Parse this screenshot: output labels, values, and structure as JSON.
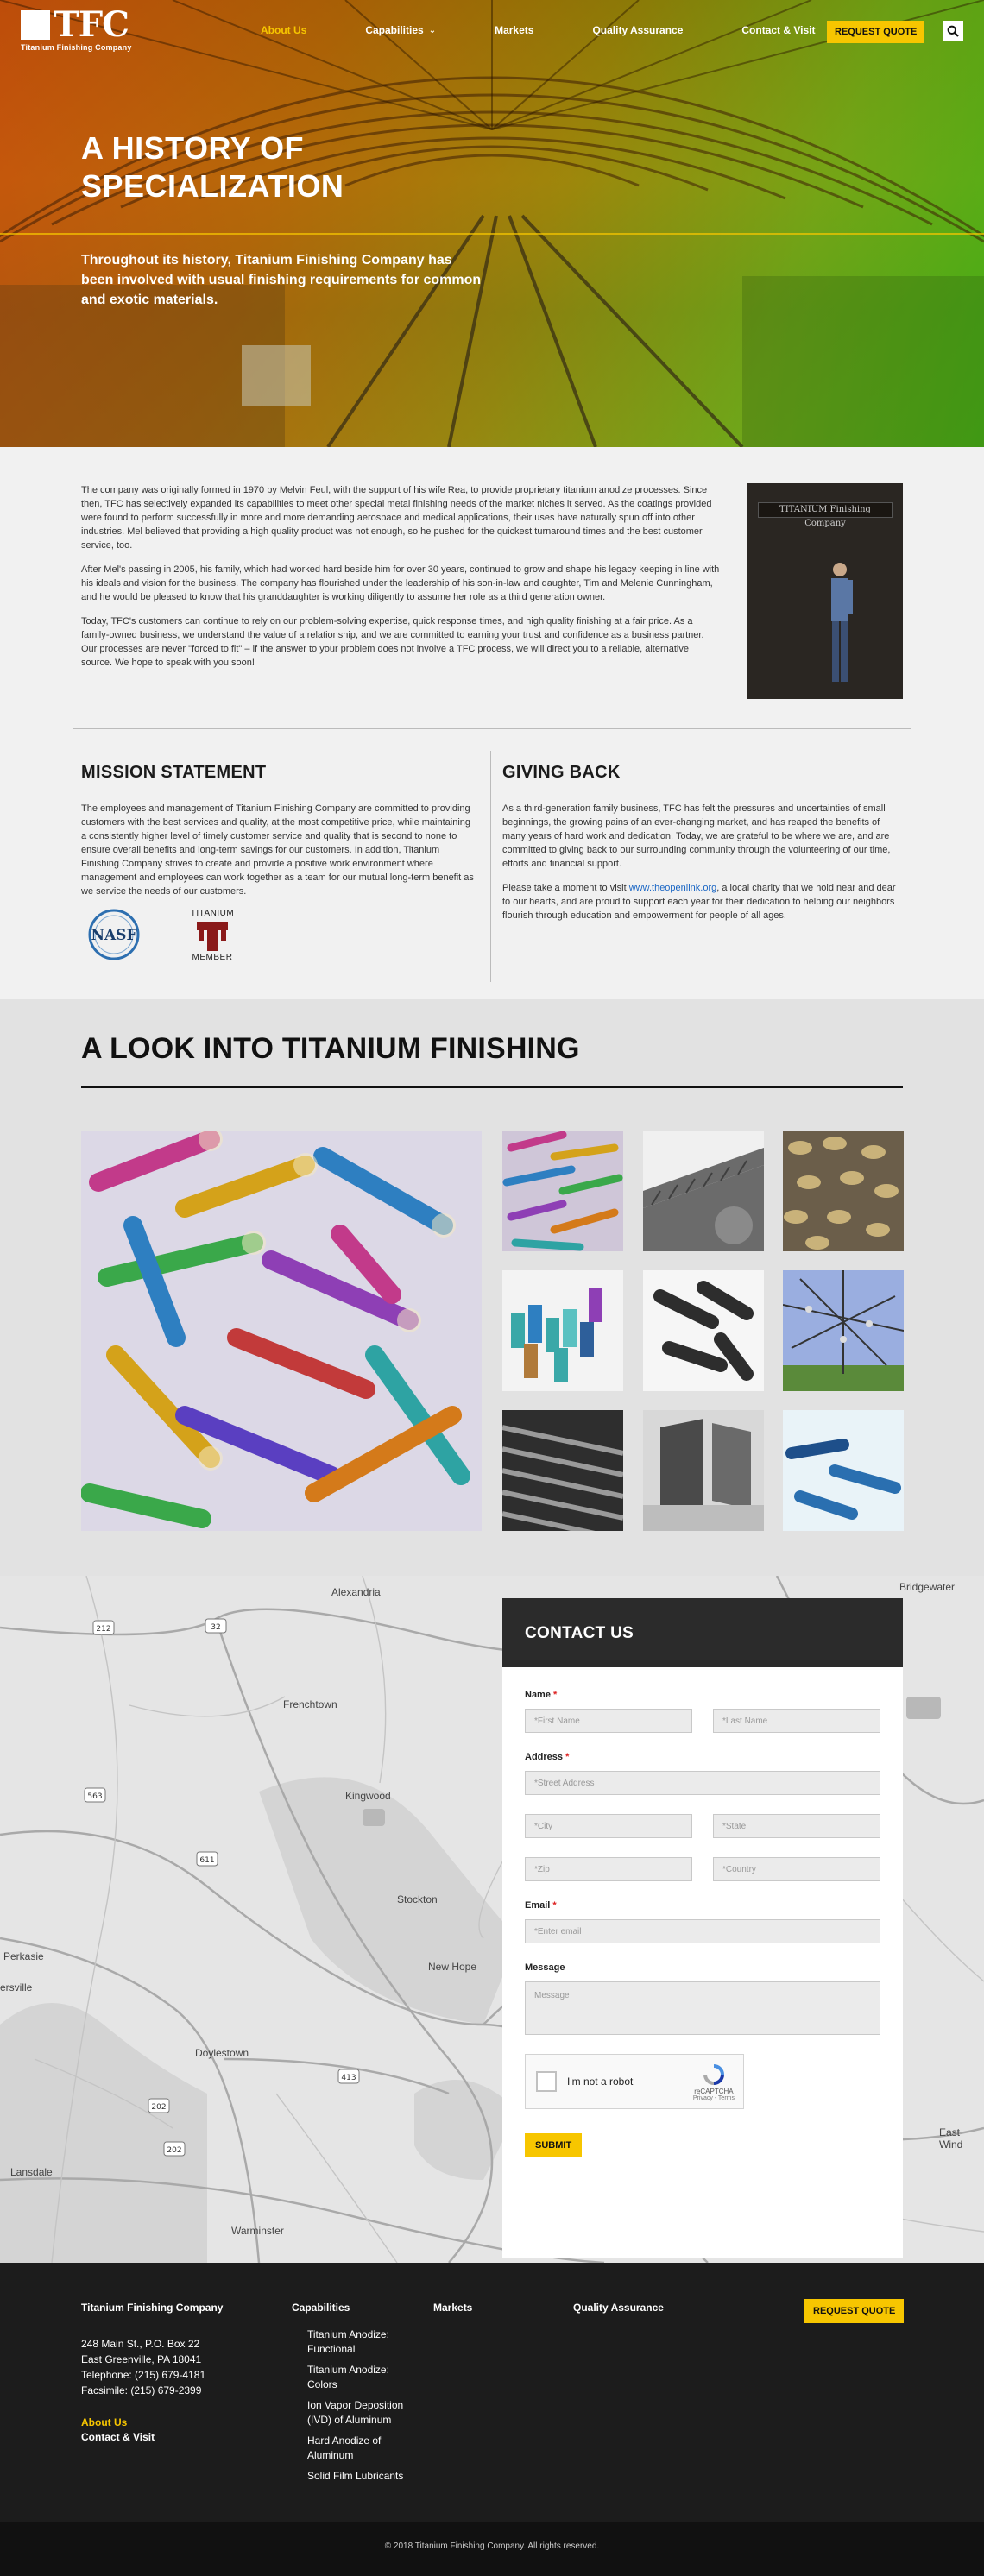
{
  "nav": {
    "logo_text": "TFC",
    "logo_sub": "Titanium Finishing Company",
    "items": [
      {
        "label": "About Us",
        "active": true
      },
      {
        "label": "Capabilities",
        "has_dropdown": true
      },
      {
        "label": "Markets"
      },
      {
        "label": "Quality Assurance"
      },
      {
        "label": "Contact & Visit"
      }
    ],
    "quote_label": "REQUEST QUOTE",
    "search_icon": "search-icon"
  },
  "hero": {
    "title": "A HISTORY OF SPECIALIZATION",
    "subtitle": "Throughout its history, Titanium Finishing Company has been involved with usual finishing requirements for common and exotic materials."
  },
  "history": {
    "paragraphs": [
      "The company was originally formed in 1970 by Melvin Feul, with the support of his wife Rea, to provide proprietary titanium anodize processes. Since then, TFC has selectively expanded its capabilities to meet other special metal finishing needs of the market niches it served. As the coatings provided were found to perform successfully in more and more demanding aerospace and medical applications, their uses have naturally spun off into other industries. Mel believed that providing a high quality product was not enough, so he pushed for the quickest turnaround times and the best customer service, too.",
      "After Mel's passing in 2005, his family, which had worked hard beside him for over 30 years, continued to grow and shape his legacy keeping in line with his ideals and vision for the business. The company has flourished under the leadership of his son-in-law and daughter, Tim and Melenie Cunningham, and he would be pleased to know that his granddaughter is working diligently to assume her role as a third generation owner.",
      "Today, TFC's customers can continue to rely on our problem-solving expertise, quick response times, and high quality finishing at a fair price. As a family-owned business, we understand the value of a relationship, and we are committed to earning your trust and confidence as a business partner. Our processes are never \"forced to fit\" – if the answer to your problem does not involve a TFC process, we will direct you to a reliable, alternative source. We hope to speak with you soon!"
    ],
    "photo_sign": "TITANIUM Finishing Company"
  },
  "mission": {
    "title": "MISSION STATEMENT",
    "text": "The employees and management of Titanium Finishing Company are committed to providing customers with the best services and quality, at the most competitive price, while maintaining a consistently higher level of timely customer service and quality that is second to none to ensure overall benefits and long-term savings for our customers. In addition, Titanium Finishing Company strives to create and provide a positive work environment where management and employees can work together as a team for our mutual long-term benefit as we service the needs of our customers.",
    "badge_nasf": "NASF",
    "badge_ti_top": "TITANIUM",
    "badge_ti_bottom": "MEMBER"
  },
  "giving": {
    "title": "GIVING BACK",
    "text1": "As a third-generation family business, TFC has felt the pressures and uncertainties of small beginnings, the growing pains of an ever-changing market, and has reaped the benefits of many years of hard work and dedication. Today, we are grateful to be where we are, and are committed to giving back to our surrounding community through the volunteering of our time, efforts and financial support.",
    "text2_before": "Please take a moment to visit ",
    "text2_link": "www.theopenlink.org",
    "text2_after": ", a local charity that we hold near and dear to our hearts, and are proud to support each year for their dedication to helping our neighbors flourish through education and empowerment for people of all ages."
  },
  "gallery": {
    "title": "A LOOK INTO TITANIUM FINISHING"
  },
  "map": {
    "labels": [
      "Alexandria",
      "Bridgewater",
      "Frenchtown",
      "Kingwood",
      "Stockton",
      "New Hope",
      "Perkasie",
      "ersville",
      "Doylestown",
      "Lansdale",
      "Warminster",
      "East Wind"
    ],
    "shields": [
      "212",
      "32",
      "611",
      "563",
      "611",
      "413",
      "202",
      "202"
    ]
  },
  "contact": {
    "title": "CONTACT US",
    "name_label": "Name",
    "first_ph": "*First Name",
    "last_ph": "*Last Name",
    "address_label": "Address",
    "street_ph": "*Street Address",
    "city_ph": "*City",
    "state_ph": "*State",
    "zip_ph": "*Zip",
    "country_ph": "*Country",
    "email_label": "Email",
    "email_ph": "*Enter email",
    "message_label": "Message",
    "message_ph": "Message",
    "required_mark": "*",
    "captcha_label": "I'm not a robot",
    "captcha_brand": "reCAPTCHA",
    "captcha_links": "Privacy - Terms",
    "submit": "SUBMIT"
  },
  "footer": {
    "company": "Titanium Finishing Company",
    "address1": "248 Main St., P.O. Box 22",
    "address2": "East Greenville, PA 18041",
    "telephone": "Telephone: (215) 679-4181",
    "facsimile": "Facsimile: (215) 679-2399",
    "about": "About Us",
    "contact": "Contact & Visit",
    "capabilities_title": "Capabilities",
    "capabilities": [
      "Titanium Anodize: Functional",
      "Titanium Anodize: Colors",
      "Ion Vapor Deposition (IVD) of Aluminum",
      "Hard Anodize of Aluminum",
      "Solid Film Lubricants"
    ],
    "markets": "Markets",
    "quality": "Quality Assurance",
    "quote": "REQUEST QUOTE",
    "copyright": "© 2018 Titanium Finishing Company. All rights reserved."
  }
}
